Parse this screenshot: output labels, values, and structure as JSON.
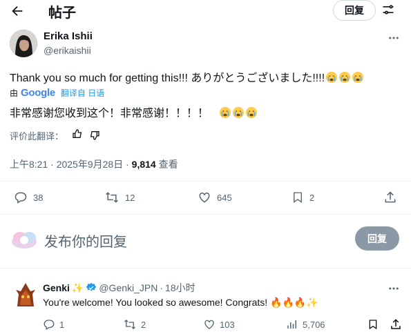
{
  "header": {
    "title": "帖子",
    "reply_button": "回复"
  },
  "post": {
    "author_name": "Erika Ishii",
    "author_handle": "@erikaishii",
    "text": "Thank you so much for getting this!!! ありがとうございました!!!!",
    "translated_by_prefix": "由",
    "google": "Google",
    "translated_from": "翻译自 日语",
    "translation": "非常感谢您收到这个！非常感谢！！！！",
    "rate_translation": "评价此翻译：",
    "time": "上午8:21",
    "date": "2025年9月28日",
    "views_count": "9,814",
    "views_label": "查看",
    "stats": {
      "replies": "38",
      "reposts": "12",
      "likes": "645",
      "bookmarks": "2"
    }
  },
  "composer": {
    "placeholder": "发布你的回复",
    "reply_button": "回复"
  },
  "reply": {
    "author_name": "Genki",
    "author_handle": "@Genki_JPN",
    "time": "18小时",
    "text": "You're welcome! You looked so awesome! Congrats!",
    "stats": {
      "replies": "1",
      "reposts": "2",
      "likes": "103",
      "views": "5,706"
    }
  },
  "colors": {
    "blue": "#1d9bf0",
    "text": "#0f1419",
    "muted": "#536471",
    "divider": "#eff3f4"
  }
}
